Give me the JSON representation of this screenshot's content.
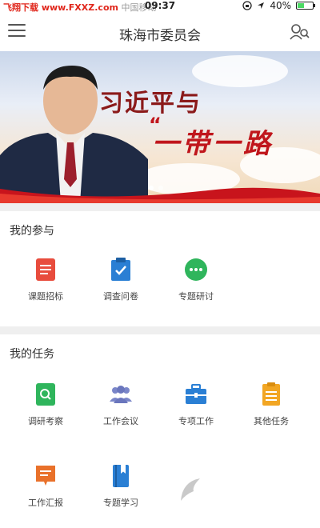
{
  "status_bar": {
    "carrier_watermark": "飞翔下载 www.FXXZ.com",
    "carrier": "中国移动",
    "time": "09:37",
    "battery_text": "40%",
    "battery_level": 0.4
  },
  "nav": {
    "title": "珠海市委员会"
  },
  "banner": {
    "headline": "习近平与",
    "subhead": "一带一路",
    "quote": "“",
    "slide_count": 2,
    "active_slide": 1
  },
  "participation": {
    "title": "我的参与",
    "items": [
      {
        "label": "课题招标",
        "icon": "document-icon",
        "color": "#e84c3d"
      },
      {
        "label": "调查问卷",
        "icon": "clipboard-check-icon",
        "color": "#2a7fd4"
      },
      {
        "label": "专题研讨",
        "icon": "chat-dots-icon",
        "color": "#2fb55c"
      }
    ]
  },
  "tasks": {
    "title": "我的任务",
    "items": [
      {
        "label": "调研考察",
        "icon": "search-doc-icon",
        "color": "#2fb55c"
      },
      {
        "label": "工作会议",
        "icon": "group-icon",
        "color": "#7a86c9"
      },
      {
        "label": "专项工作",
        "icon": "briefcase-icon",
        "color": "#2a7fd4"
      },
      {
        "label": "其他任务",
        "icon": "list-doc-icon",
        "color": "#f2a623"
      },
      {
        "label": "工作汇报",
        "icon": "report-icon",
        "color": "#e9712a"
      },
      {
        "label": "专题学习",
        "icon": "book-icon",
        "color": "#2a7fd4"
      }
    ]
  },
  "watermark": {
    "brand": "飞翔下载",
    "url": "www.FXXZ.com"
  }
}
